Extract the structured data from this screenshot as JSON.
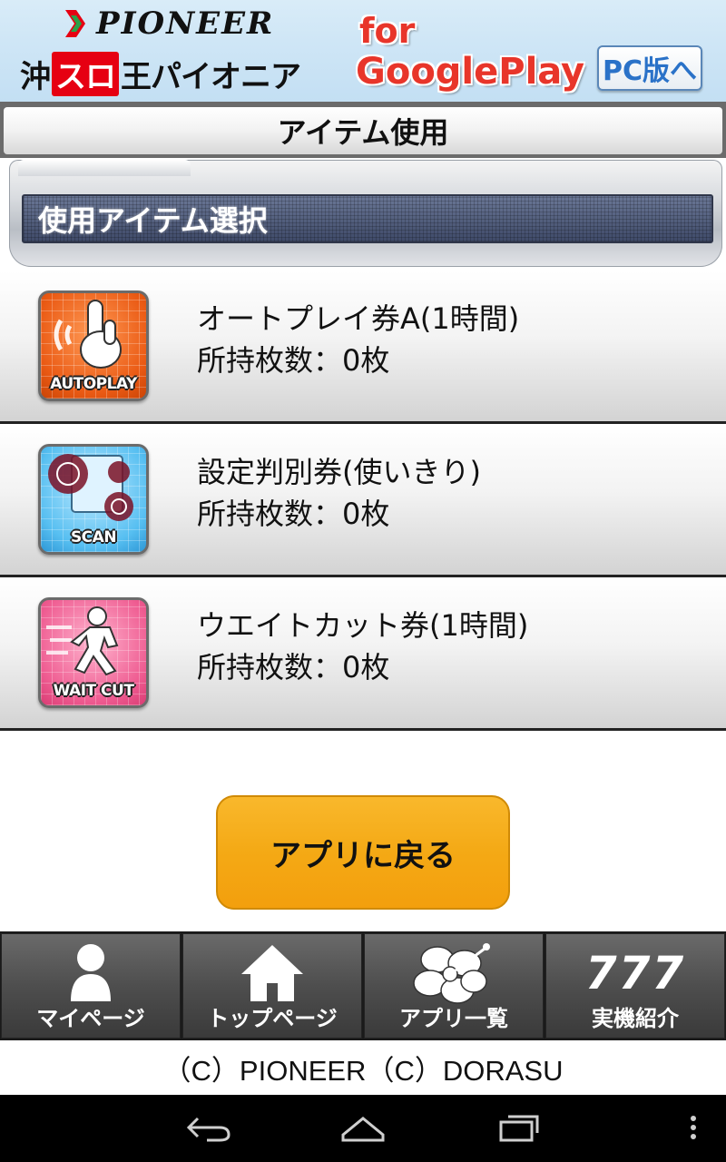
{
  "header": {
    "pioneer_logo": "PIONEER",
    "brand_name_parts": [
      "沖",
      "スロ",
      "王パイオニア"
    ],
    "for_text": "for",
    "googleplay_text": "GooglePlay",
    "pc_button_label": "PC版へ"
  },
  "title_bar": {
    "title": "アイテム使用"
  },
  "section": {
    "title": "使用アイテム選択"
  },
  "items": [
    {
      "icon": "autoplay-icon",
      "icon_caption": "AUTOPLAY",
      "name": "オートプレイ券A(1時間)",
      "count_label": "所持枚数：0枚"
    },
    {
      "icon": "scan-icon",
      "icon_caption": "SCAN",
      "name": "設定判別券(使いきり)",
      "count_label": "所持枚数：0枚"
    },
    {
      "icon": "wait-cut-icon",
      "icon_caption": "WAIT CUT",
      "name": "ウエイトカット券(1時間)",
      "count_label": "所持枚数：0枚"
    }
  ],
  "back_button": {
    "label": "アプリに戻る"
  },
  "bottom_nav": [
    {
      "icon": "person-icon",
      "label": "マイページ"
    },
    {
      "icon": "home-icon",
      "label": "トップページ"
    },
    {
      "icon": "hibiscus-icon",
      "label": "アプリ一覧"
    },
    {
      "icon": "seven-seven-seven-icon",
      "label": "実機紹介",
      "icon_text": "777"
    }
  ],
  "footer": {
    "copyright": "（C）PIONEER（C）DORASU"
  },
  "colors": {
    "header_bg": "#cfe6f6",
    "back_button": "#f4a915",
    "google_play_text": "#e8352a",
    "pc_button_text": "#2a72c8",
    "nav_bg": "#4e4e4e"
  }
}
